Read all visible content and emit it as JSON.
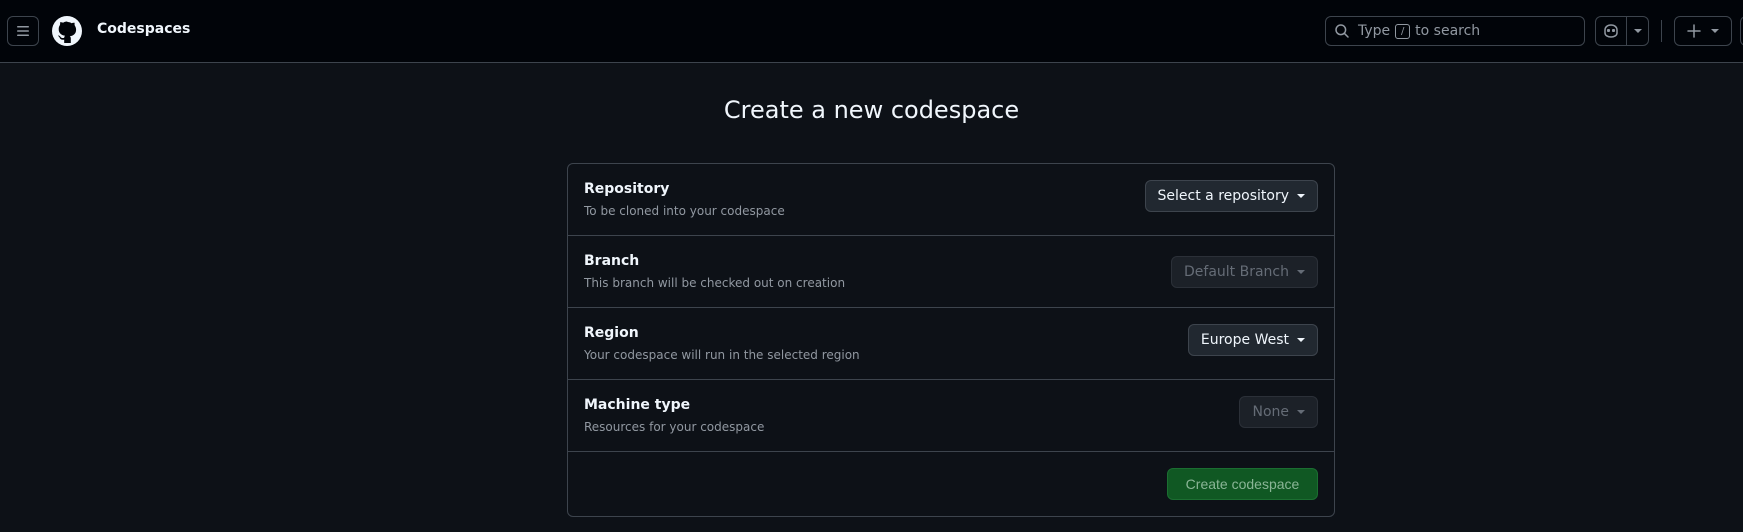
{
  "header": {
    "title": "Codespaces",
    "search": {
      "prefix": "Type",
      "key": "/",
      "suffix": "to search"
    }
  },
  "main": {
    "page_title": "Create a new codespace",
    "rows": [
      {
        "label": "Repository",
        "description": "To be cloned into your codespace",
        "value": "Select a repository",
        "disabled": false
      },
      {
        "label": "Branch",
        "description": "This branch will be checked out on creation",
        "value": "Default Branch",
        "disabled": true
      },
      {
        "label": "Region",
        "description": "Your codespace will run in the selected region",
        "value": "Europe West",
        "disabled": false
      },
      {
        "label": "Machine type",
        "description": "Resources for your codespace",
        "value": "None",
        "disabled": true
      }
    ],
    "create_button": "Create codespace"
  },
  "colors": {
    "background": "#0d1117",
    "header_background": "#010409",
    "border": "#3d444d",
    "primary_button": "#105823"
  },
  "icons": [
    "hamburger-icon",
    "github-logo-icon",
    "search-icon",
    "copilot-icon",
    "chevron-down-icon",
    "plus-icon"
  ]
}
